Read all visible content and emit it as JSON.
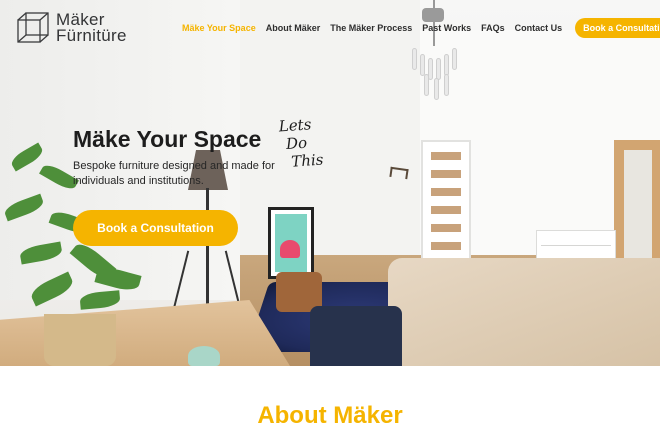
{
  "brand": {
    "name_line1": "Mäker",
    "name_line2": "Fürnitüre",
    "logo_icon": "wireframe-cube-icon"
  },
  "nav": {
    "items": [
      {
        "label": "Mäke Your Space",
        "active": true
      },
      {
        "label": "About Mäker",
        "active": false
      },
      {
        "label": "The Mäker Process",
        "active": false
      },
      {
        "label": "Past Works",
        "active": false
      },
      {
        "label": "FAQs",
        "active": false
      },
      {
        "label": "Contact Us",
        "active": false
      }
    ],
    "cta_label": "Book a Consultation"
  },
  "hero": {
    "title": "Mäke Your Space",
    "subtitle": "Bespoke furniture designed and made for individuals and institutions.",
    "cta_label": "Book a Consultation",
    "wall_lettering": [
      "Lets",
      "Do",
      "This"
    ]
  },
  "about": {
    "title": "About Mäker"
  },
  "colors": {
    "accent": "#f5b400",
    "text_dark": "#1d1d1d",
    "white": "#ffffff"
  }
}
